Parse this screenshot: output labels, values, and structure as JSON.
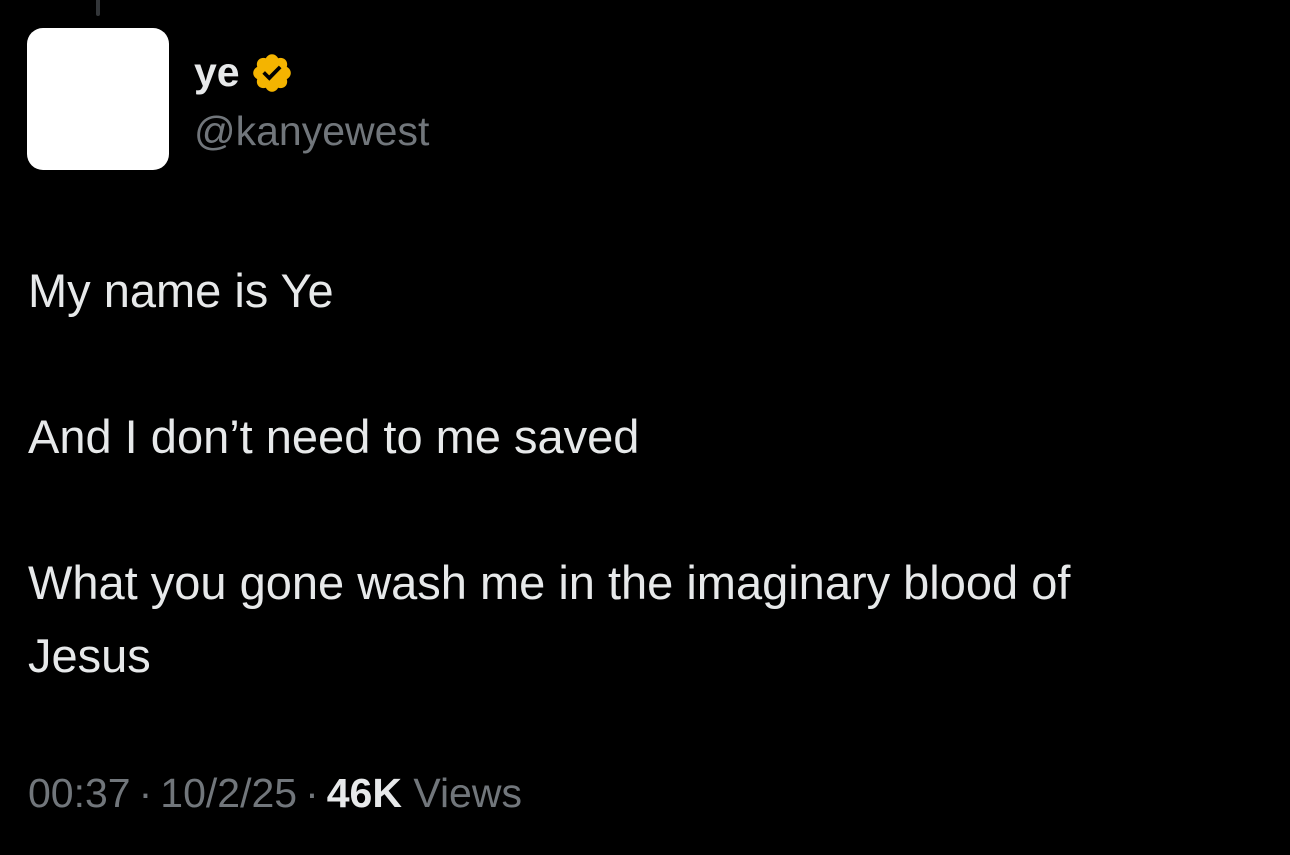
{
  "author": {
    "display_name": "ye",
    "handle": "@kanyewest",
    "verified": true,
    "badge_color": "#f4b400",
    "icon": "verified-badge-icon"
  },
  "tweet": {
    "lines": [
      "My name is Ye",
      "",
      "And I don’t need to me saved",
      "",
      "What you gone wash me in the imaginary blood of",
      "Jesus"
    ]
  },
  "meta": {
    "time": "00:37",
    "separator": "·",
    "date": "10/2/25",
    "views_count": "46K",
    "views_label": "Views"
  },
  "colors": {
    "background": "#000000",
    "primary_text": "#e7e9ea",
    "secondary_text": "#71767b"
  }
}
